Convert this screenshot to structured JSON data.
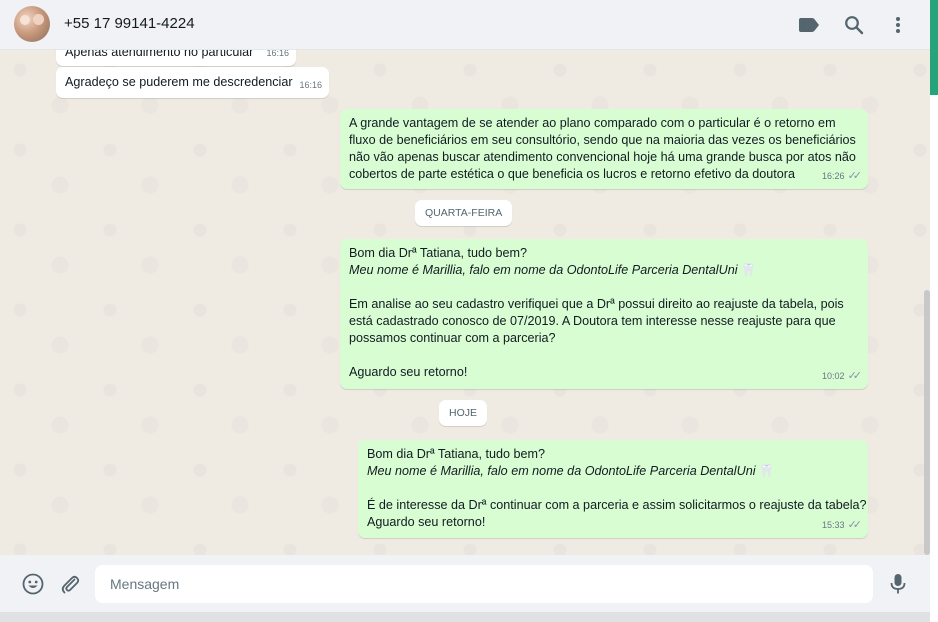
{
  "header": {
    "contact_name": "+55 17 99141-4224"
  },
  "colors": {
    "outgoing_bubble": "#d9fdd3",
    "incoming_bubble": "#ffffff",
    "header_bg": "#f0f2f5",
    "chat_bg": "#efeae2"
  },
  "icons": {
    "header": [
      "label-icon",
      "search-icon",
      "menu-dots-icon"
    ],
    "footer": [
      "emoji-icon",
      "attach-icon",
      "microphone-icon"
    ]
  },
  "messages": {
    "m1": {
      "text": "Apenas atendimento no particular",
      "time": "16:16"
    },
    "m2": {
      "text": "Agradeço se puderem me descredenciar",
      "time": "16:16"
    },
    "m3": {
      "lines": [
        "A grande vantagem de se atender ao plano comparado com o particular é o retorno em",
        "fluxo de beneficiários em seu consultório, sendo que na maioria das vezes os beneficiários",
        "não vão apenas buscar atendimento convencional hoje há uma grande busca por atos não",
        "cobertos de parte estética o que beneficia os lucros e retorno efetivo da doutora"
      ],
      "time": "16:26"
    },
    "day1": "QUARTA-FEIRA",
    "m4": {
      "greeting": "Bom dia Drª Tatiana, tudo bem?",
      "intro": "Meu nome é Marillia, falo em nome da OdontoLife Parceria DentalUni",
      "body_lines": [
        "Em analise ao seu cadastro verifiquei que a Drª possui direito ao reajuste da tabela, pois",
        "está cadastrado conosco de 07/2019. A Doutora tem interesse nesse reajuste para que",
        "possamos continuar com a parceria?"
      ],
      "closing": "Aguardo seu retorno!",
      "time": "10:02"
    },
    "day2": "HOJE",
    "m5": {
      "greeting": "Bom dia Drª Tatiana, tudo bem?",
      "intro": "Meu nome é Marillia, falo em nome da OdontoLife Parceria DentalUni",
      "body_lines": [
        "É de interesse da Drª continuar com a parceria e assim solicitarmos o reajuste da tabela?",
        "Aguardo seu retorno!"
      ],
      "time": "15:33"
    }
  },
  "composer": {
    "placeholder": "Mensagem",
    "value": ""
  }
}
